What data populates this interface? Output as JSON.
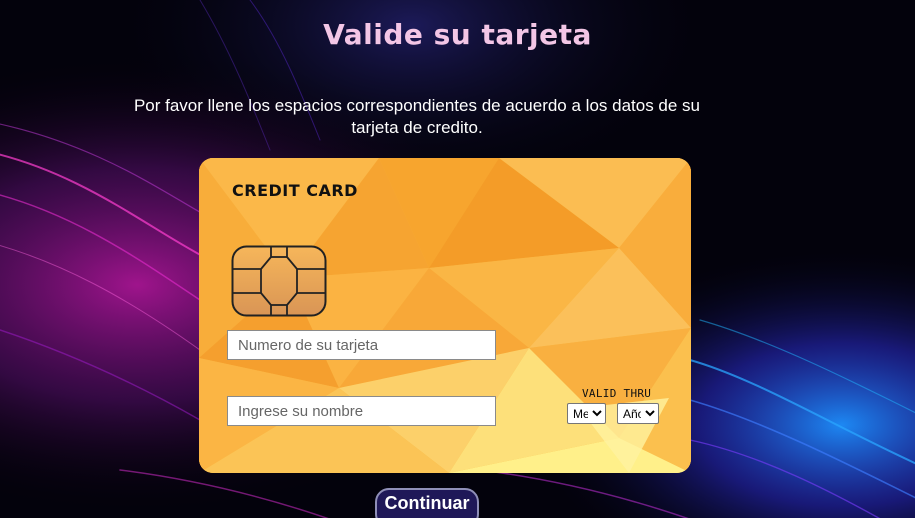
{
  "page": {
    "title": "Valide su tarjeta",
    "instructions": "Por favor llene los espacios correspondientes de acuerdo a los datos de su tarjeta de credito."
  },
  "card": {
    "label": "CREDIT CARD",
    "chip_icon": "sim-chip-icon",
    "number_field": {
      "placeholder": "Numero de su tarjeta",
      "value": ""
    },
    "name_field": {
      "placeholder": "Ingrese su nombre",
      "value": ""
    },
    "valid_thru_label": "VALID THRU",
    "month_select": {
      "selected": "Mes",
      "options": [
        "Mes"
      ]
    },
    "year_select": {
      "selected": "Año",
      "options": [
        "Año"
      ]
    }
  },
  "actions": {
    "continue_label": "Continuar"
  },
  "colors": {
    "title": "#f3c6e6",
    "card_base": "#f9b43a",
    "button_bg": "#1f1858",
    "background": "#02010a"
  }
}
